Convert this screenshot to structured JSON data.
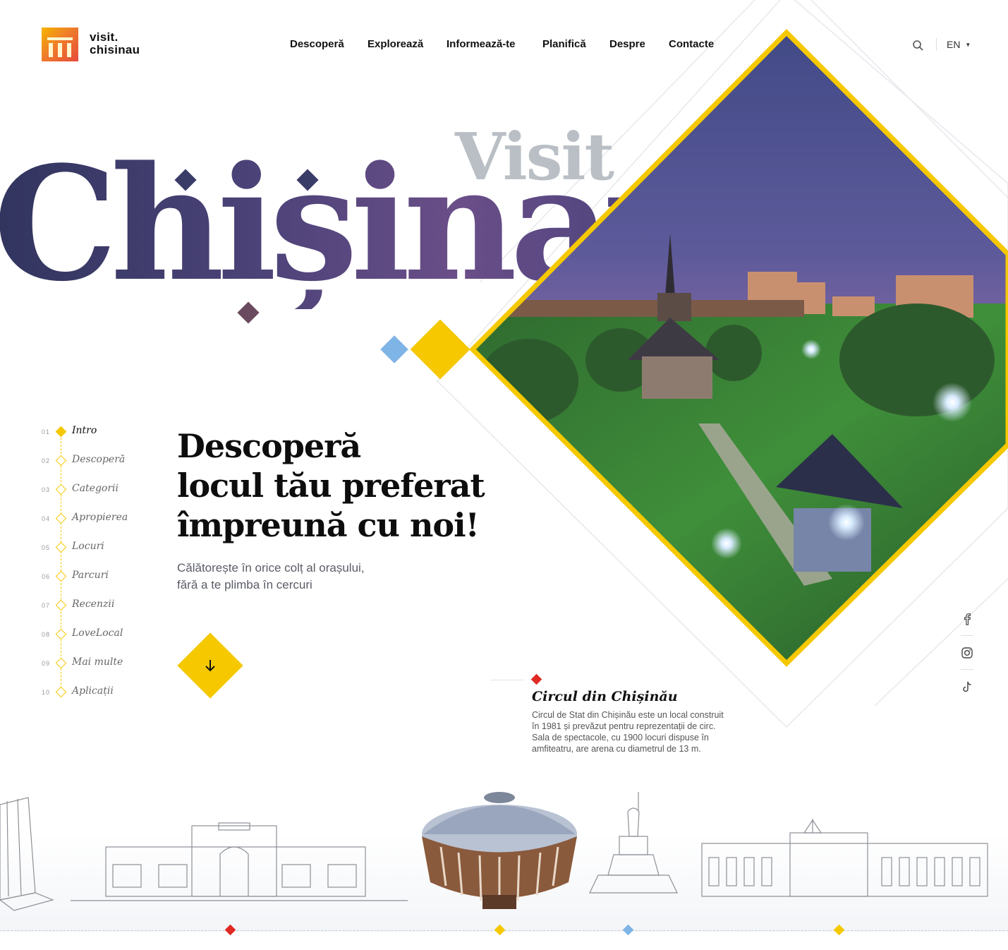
{
  "header": {
    "logo_line1": "visit.",
    "logo_line2": "chisinau",
    "nav": [
      "Descoperă",
      "Explorează",
      "Informează-te",
      "Planifică",
      "Despre",
      "Contacte"
    ],
    "language": "EN"
  },
  "hero": {
    "visit_word": "Visit",
    "city_word": "Chișinau",
    "heading_lines": [
      "Descoperă",
      "locul tău preferat",
      "împreună cu noi!"
    ],
    "subtitle_lines": [
      "Călătorește în orice colț al orașului,",
      "fără a te plimba în cercuri"
    ]
  },
  "side_nav": [
    {
      "num": "01",
      "label": "Intro",
      "active": true
    },
    {
      "num": "02",
      "label": "Descoperă",
      "active": false
    },
    {
      "num": "03",
      "label": "Categorii",
      "active": false
    },
    {
      "num": "04",
      "label": "Apropierea",
      "active": false
    },
    {
      "num": "05",
      "label": "Locuri",
      "active": false
    },
    {
      "num": "06",
      "label": "Parcuri",
      "active": false
    },
    {
      "num": "07",
      "label": "Recenzii",
      "active": false
    },
    {
      "num": "08",
      "label": "LoveLocal",
      "active": false
    },
    {
      "num": "09",
      "label": "Mai multe",
      "active": false
    },
    {
      "num": "10",
      "label": "Aplicații",
      "active": false
    }
  ],
  "info_card": {
    "title": "Circul din Chișinău",
    "text": "Circul de Stat din Chișinău este un local construit în 1981 și prevăzut pentru reprezentații de circ. Sala de spectacole, cu 1900 locuri dispuse în amfiteatru, are arena cu diametrul de 13 m."
  },
  "social": [
    "facebook-icon",
    "instagram-icon",
    "tiktok-icon"
  ],
  "colors": {
    "accent_yellow": "#f5c800",
    "accent_red": "#e02a24",
    "accent_blue": "#7fb4e6",
    "city_gradient_start": "#31355e",
    "city_gradient_end": "#6a4e88"
  }
}
